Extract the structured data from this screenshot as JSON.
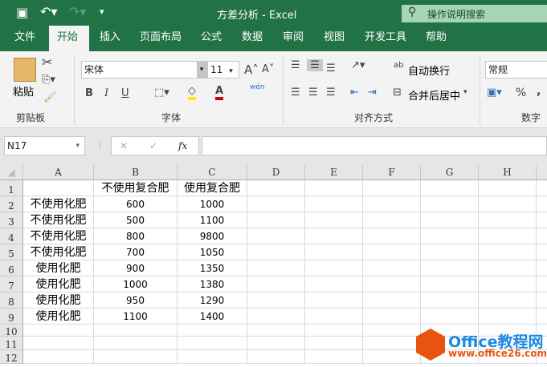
{
  "title": "方差分析  -  Excel",
  "search_placeholder": "操作说明搜索",
  "tabs": [
    "文件",
    "开始",
    "插入",
    "页面布局",
    "公式",
    "数据",
    "审阅",
    "视图",
    "开发工具",
    "帮助"
  ],
  "active_tab": "开始",
  "ribbon": {
    "clipboard": {
      "paste": "粘贴",
      "label": "剪贴板"
    },
    "font": {
      "name": "宋体",
      "size": "11",
      "label": "字体",
      "bold": "B",
      "italic": "I",
      "underline": "U",
      "phonetic": "wén"
    },
    "alignment": {
      "wrap": "自动换行",
      "merge": "合并后居中",
      "label": "对齐方式"
    },
    "number": {
      "format": "常规",
      "percent": "%",
      "comma": ",",
      "label": "数字"
    }
  },
  "formula_bar": {
    "name_box": "N17",
    "fx": "fx",
    "cancel": "✕",
    "enter": "✓",
    "value": ""
  },
  "columns": [
    "A",
    "B",
    "C",
    "D",
    "E",
    "F",
    "G",
    "H"
  ],
  "rows": [
    "1",
    "2",
    "3",
    "4",
    "5",
    "6",
    "7",
    "8",
    "9",
    "10",
    "11",
    "12"
  ],
  "cells": [
    [
      "",
      "不使用复合肥",
      "使用复合肥"
    ],
    [
      "不使用化肥",
      "600",
      "1000"
    ],
    [
      "不使用化肥",
      "500",
      "1100"
    ],
    [
      "不使用化肥",
      "800",
      "9800"
    ],
    [
      "不使用化肥",
      "700",
      "1050"
    ],
    [
      "使用化肥",
      "900",
      "1350"
    ],
    [
      "使用化肥",
      "1000",
      "1380"
    ],
    [
      "使用化肥",
      "950",
      "1290"
    ],
    [
      "使用化肥",
      "1100",
      "1400"
    ]
  ],
  "watermark": {
    "brand": "Office教程网",
    "url": "www.office26.com"
  },
  "colors": {
    "excel_green": "#217346",
    "watermark_blue": "#1e88e5",
    "watermark_orange": "#e8540f"
  }
}
